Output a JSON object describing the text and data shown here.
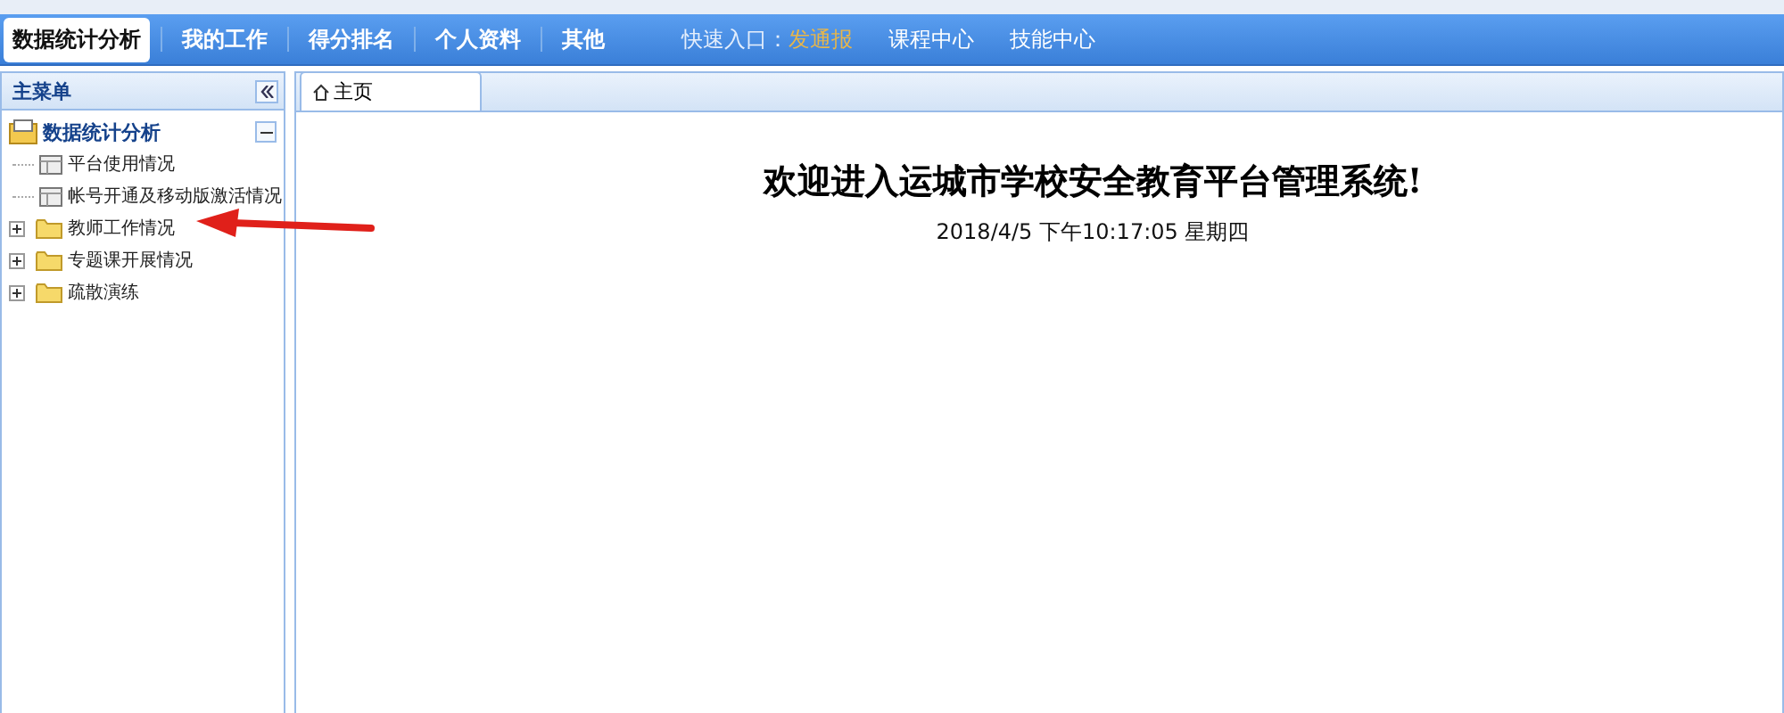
{
  "nav": {
    "items": [
      {
        "label": "数据统计分析",
        "selected": true
      },
      {
        "label": "我的工作",
        "selected": false
      },
      {
        "label": "得分排名",
        "selected": false
      },
      {
        "label": "个人资料",
        "selected": false
      },
      {
        "label": "其他",
        "selected": false
      }
    ],
    "quick_label": "快速入口：",
    "quick_links": [
      {
        "label": "发通报",
        "kind": "highlight"
      },
      {
        "label": "课程中心",
        "kind": "plain"
      },
      {
        "label": "技能中心",
        "kind": "plain"
      }
    ]
  },
  "sidebar": {
    "title": "主菜单",
    "tree": [
      {
        "label": "数据统计分析",
        "kind": "root",
        "expanded": true,
        "children": [
          {
            "label": "平台使用情况",
            "kind": "page"
          },
          {
            "label": "帐号开通及移动版激活情况",
            "kind": "page"
          }
        ]
      },
      {
        "label": "教师工作情况",
        "kind": "folder",
        "expanded": false
      },
      {
        "label": "专题课开展情况",
        "kind": "folder",
        "expanded": false
      },
      {
        "label": "疏散演练",
        "kind": "folder",
        "expanded": false
      }
    ]
  },
  "tabs": [
    {
      "label": "主页",
      "selected": true
    }
  ],
  "main": {
    "heading": "欢迎进入运城市学校安全教育平台管理系统!",
    "datetime": "2018/4/5 下午10:17:05 星期四"
  }
}
